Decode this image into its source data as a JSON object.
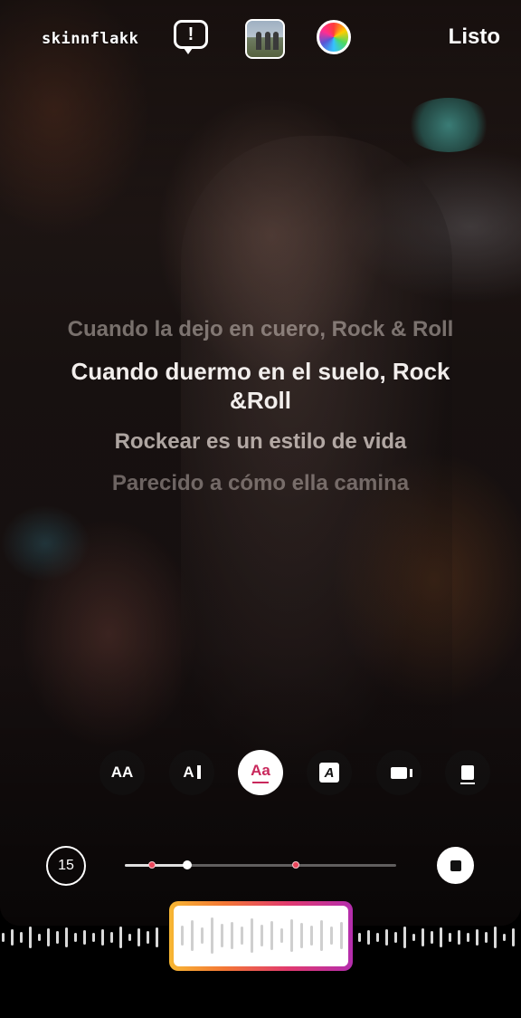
{
  "header": {
    "username": "skinnflakk",
    "done_label": "Listo",
    "warning_glyph": "!"
  },
  "lyrics": [
    "Cuando la dejo en cuero, Rock & Roll",
    "Cuando duermo en el suelo, Rock &Roll",
    "Rockear es un estilo de vida",
    "Parecido a cómo ella camina"
  ],
  "style_options": [
    {
      "icon": "text-size-icon",
      "glyph": "AA",
      "active": false
    },
    {
      "icon": "text-cursor-icon",
      "glyph": "A",
      "active": false
    },
    {
      "icon": "text-style-icon",
      "glyph": "Aa",
      "active": true
    },
    {
      "icon": "text-box-icon",
      "glyph": "A",
      "active": false
    },
    {
      "icon": "video-icon",
      "glyph": "",
      "active": false
    },
    {
      "icon": "card-icon",
      "glyph": "",
      "active": false
    }
  ],
  "timeline": {
    "duration_label": "15",
    "progress": 0.23,
    "markers": [
      0.1,
      0.63
    ]
  },
  "colors": {
    "accent": "#c9285c",
    "marker": "#e8455a",
    "selector_gradient": [
      "#f7b733",
      "#f37735",
      "#e03a6f",
      "#b42dad"
    ]
  }
}
